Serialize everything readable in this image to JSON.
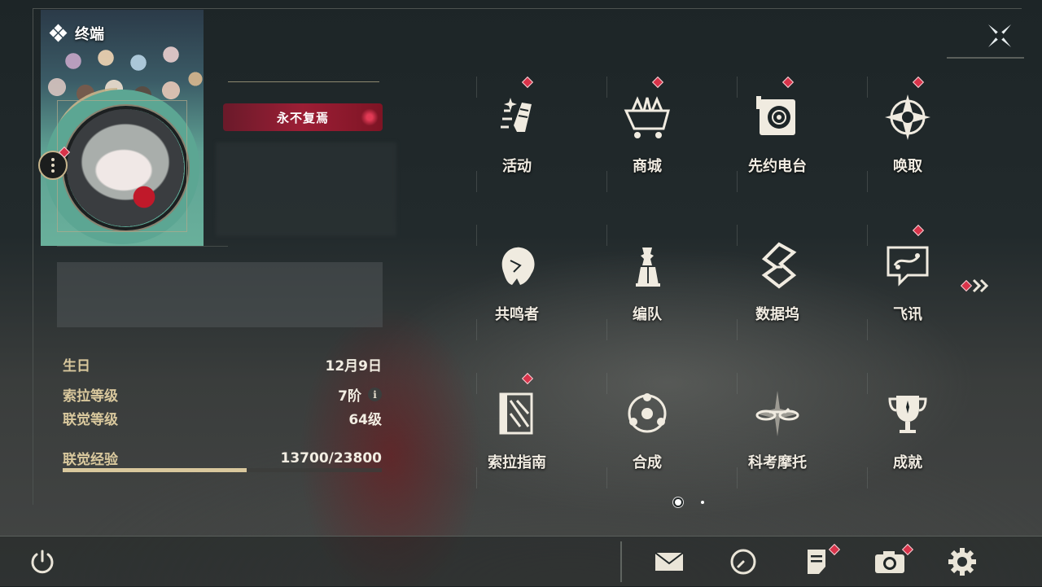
{
  "header": {
    "title": "终端"
  },
  "profile": {
    "title_badge": "永不复焉",
    "stats": [
      {
        "label": "生日",
        "value": "12月9日"
      },
      {
        "label": "索拉等级",
        "value": "7阶"
      },
      {
        "label": "联觉等级",
        "value": "64级"
      }
    ],
    "exp": {
      "label": "联觉经验",
      "value": "13700/23800",
      "progress": 0.576
    }
  },
  "menu": [
    {
      "label": "活动",
      "icon": "activity-icon",
      "badge": true
    },
    {
      "label": "商城",
      "icon": "shop-cart-icon",
      "badge": true
    },
    {
      "label": "先约电台",
      "icon": "radio-icon",
      "badge": true
    },
    {
      "label": "唤取",
      "icon": "summon-compass-icon",
      "badge": true
    },
    {
      "label": "共鸣者",
      "icon": "resonator-head-icon",
      "badge": false
    },
    {
      "label": "编队",
      "icon": "team-chess-icon",
      "badge": false
    },
    {
      "label": "数据坞",
      "icon": "data-bank-icon",
      "badge": false
    },
    {
      "label": "飞讯",
      "icon": "chat-bubble-icon",
      "badge": true
    },
    {
      "label": "索拉指南",
      "icon": "guide-book-icon",
      "badge": true
    },
    {
      "label": "合成",
      "icon": "synthesis-icon",
      "badge": false
    },
    {
      "label": "科考摩托",
      "icon": "motorbike-icon",
      "badge": false
    },
    {
      "label": "成就",
      "icon": "trophy-icon",
      "badge": false
    }
  ],
  "pager": {
    "current": 1,
    "total": 2
  },
  "bottom": [
    "power-icon",
    "mail-icon",
    "clock-icon",
    "notes-icon",
    "camera-icon",
    "settings-gear-icon"
  ],
  "colors": {
    "accent": "#d9c89d",
    "badge": "#d9334a",
    "title_badge": "#9c1e35"
  }
}
